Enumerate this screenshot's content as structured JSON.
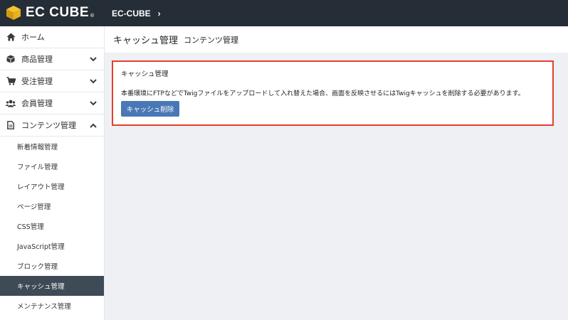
{
  "header": {
    "logo_text": "EC CUBE",
    "logo_dot": "®",
    "shop_name": "EC-CUBE",
    "shop_chevron": "›"
  },
  "sidebar": {
    "items": [
      {
        "label": "ホーム",
        "icon": "home-icon",
        "chevron": ""
      },
      {
        "label": "商品管理",
        "icon": "cube-icon",
        "chevron": "down"
      },
      {
        "label": "受注管理",
        "icon": "cart-icon",
        "chevron": "down"
      },
      {
        "label": "会員管理",
        "icon": "users-icon",
        "chevron": "down"
      },
      {
        "label": "コンテンツ管理",
        "icon": "file-icon",
        "chevron": "up"
      }
    ],
    "sub_items": [
      "新着情報管理",
      "ファイル管理",
      "レイアウト管理",
      "ページ管理",
      "CSS管理",
      "JavaScript管理",
      "ブロック管理",
      "キャッシュ管理",
      "メンテナンス管理"
    ],
    "active_sub_item": "キャッシュ管理"
  },
  "page": {
    "title": "キャッシュ管理",
    "subtitle": "コンテンツ管理"
  },
  "card": {
    "title": "キャッシュ管理",
    "description": "本番環境にFTPなどでTwigファイルをアップロードして入れ替えた場合、画面を反映させるにはTwigキャッシュを削除する必要があります。",
    "button_label": "キャッシュ削除"
  },
  "colors": {
    "topbar": "#252d37",
    "accent_button": "#4a78b6",
    "highlight_border": "#e2402b",
    "active_sub_bg": "#3e4a56"
  }
}
